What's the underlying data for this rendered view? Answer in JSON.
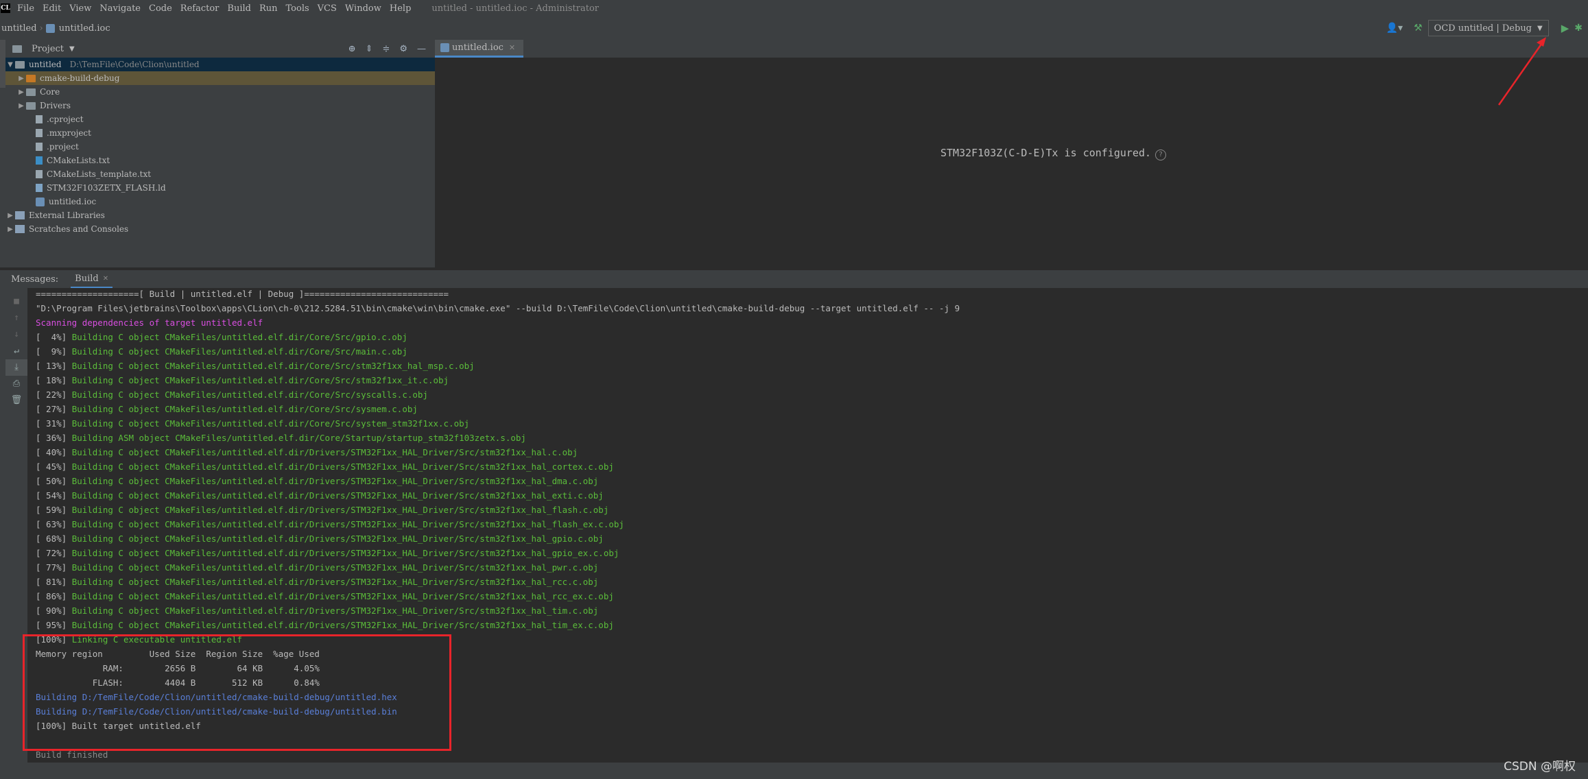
{
  "app": {
    "logo": "CL",
    "window_title": "untitled - untitled.ioc - Administrator"
  },
  "menu": [
    "File",
    "Edit",
    "View",
    "Navigate",
    "Code",
    "Refactor",
    "Build",
    "Run",
    "Tools",
    "VCS",
    "Window",
    "Help"
  ],
  "breadcrumb": {
    "project": "untitled",
    "file": "untitled.ioc"
  },
  "toolbar": {
    "run_config": "OCD untitled | Debug"
  },
  "project_panel": {
    "title": "Project"
  },
  "tree": {
    "root": {
      "label": "untitled",
      "path": "D:\\TemFile\\Code\\Clion\\untitled"
    },
    "items": [
      {
        "label": "cmake-build-debug"
      },
      {
        "label": "Core"
      },
      {
        "label": "Drivers"
      },
      {
        "label": ".cproject"
      },
      {
        "label": ".mxproject"
      },
      {
        "label": ".project"
      },
      {
        "label": "CMakeLists.txt"
      },
      {
        "label": "CMakeLists_template.txt"
      },
      {
        "label": "STM32F103ZETX_FLASH.ld"
      },
      {
        "label": "untitled.ioc"
      }
    ],
    "external": "External Libraries",
    "scratches": "Scratches and Consoles"
  },
  "editor": {
    "tab": "untitled.ioc",
    "message": "STM32F103Z(C-D-E)Tx is configured.",
    "help_glyph": "?"
  },
  "messages": {
    "label": "Messages:",
    "tab": "Build"
  },
  "console": {
    "header": "====================[ Build | untitled.elf | Debug ]============================",
    "command": "\"D:\\Program Files\\jetbrains\\Toolbox\\apps\\CLion\\ch-0\\212.5284.51\\bin\\cmake\\win\\bin\\cmake.exe\" --build D:\\TemFile\\Code\\Clion\\untitled\\cmake-build-debug --target untitled.elf -- -j 9",
    "scanning": "Scanning dependencies of target untitled.elf",
    "build_lines": [
      {
        "pct": "[  4%]",
        "text": "Building C object CMakeFiles/untitled.elf.dir/Core/Src/gpio.c.obj"
      },
      {
        "pct": "[  9%]",
        "text": "Building C object CMakeFiles/untitled.elf.dir/Core/Src/main.c.obj"
      },
      {
        "pct": "[ 13%]",
        "text": "Building C object CMakeFiles/untitled.elf.dir/Core/Src/stm32f1xx_hal_msp.c.obj"
      },
      {
        "pct": "[ 18%]",
        "text": "Building C object CMakeFiles/untitled.elf.dir/Core/Src/stm32f1xx_it.c.obj"
      },
      {
        "pct": "[ 22%]",
        "text": "Building C object CMakeFiles/untitled.elf.dir/Core/Src/syscalls.c.obj"
      },
      {
        "pct": "[ 27%]",
        "text": "Building C object CMakeFiles/untitled.elf.dir/Core/Src/sysmem.c.obj"
      },
      {
        "pct": "[ 31%]",
        "text": "Building C object CMakeFiles/untitled.elf.dir/Core/Src/system_stm32f1xx.c.obj"
      },
      {
        "pct": "[ 36%]",
        "text": "Building ASM object CMakeFiles/untitled.elf.dir/Core/Startup/startup_stm32f103zetx.s.obj"
      },
      {
        "pct": "[ 40%]",
        "text": "Building C object CMakeFiles/untitled.elf.dir/Drivers/STM32F1xx_HAL_Driver/Src/stm32f1xx_hal.c.obj"
      },
      {
        "pct": "[ 45%]",
        "text": "Building C object CMakeFiles/untitled.elf.dir/Drivers/STM32F1xx_HAL_Driver/Src/stm32f1xx_hal_cortex.c.obj"
      },
      {
        "pct": "[ 50%]",
        "text": "Building C object CMakeFiles/untitled.elf.dir/Drivers/STM32F1xx_HAL_Driver/Src/stm32f1xx_hal_dma.c.obj"
      },
      {
        "pct": "[ 54%]",
        "text": "Building C object CMakeFiles/untitled.elf.dir/Drivers/STM32F1xx_HAL_Driver/Src/stm32f1xx_hal_exti.c.obj"
      },
      {
        "pct": "[ 59%]",
        "text": "Building C object CMakeFiles/untitled.elf.dir/Drivers/STM32F1xx_HAL_Driver/Src/stm32f1xx_hal_flash.c.obj"
      },
      {
        "pct": "[ 63%]",
        "text": "Building C object CMakeFiles/untitled.elf.dir/Drivers/STM32F1xx_HAL_Driver/Src/stm32f1xx_hal_flash_ex.c.obj"
      },
      {
        "pct": "[ 68%]",
        "text": "Building C object CMakeFiles/untitled.elf.dir/Drivers/STM32F1xx_HAL_Driver/Src/stm32f1xx_hal_gpio.c.obj"
      },
      {
        "pct": "[ 72%]",
        "text": "Building C object CMakeFiles/untitled.elf.dir/Drivers/STM32F1xx_HAL_Driver/Src/stm32f1xx_hal_gpio_ex.c.obj"
      },
      {
        "pct": "[ 77%]",
        "text": "Building C object CMakeFiles/untitled.elf.dir/Drivers/STM32F1xx_HAL_Driver/Src/stm32f1xx_hal_pwr.c.obj"
      },
      {
        "pct": "[ 81%]",
        "text": "Building C object CMakeFiles/untitled.elf.dir/Drivers/STM32F1xx_HAL_Driver/Src/stm32f1xx_hal_rcc.c.obj"
      },
      {
        "pct": "[ 86%]",
        "text": "Building C object CMakeFiles/untitled.elf.dir/Drivers/STM32F1xx_HAL_Driver/Src/stm32f1xx_hal_rcc_ex.c.obj"
      },
      {
        "pct": "[ 90%]",
        "text": "Building C object CMakeFiles/untitled.elf.dir/Drivers/STM32F1xx_HAL_Driver/Src/stm32f1xx_hal_tim.c.obj"
      },
      {
        "pct": "[ 95%]",
        "text": "Building C object CMakeFiles/untitled.elf.dir/Drivers/STM32F1xx_HAL_Driver/Src/stm32f1xx_hal_tim_ex.c.obj"
      }
    ],
    "linking_pct": "[100%]",
    "linking_text": "Linking C executable untitled.elf",
    "memory_header": "Memory region         Used Size  Region Size  %age Used",
    "memory_ram": "             RAM:        2656 B        64 KB      4.05%",
    "memory_flash": "           FLASH:        4404 B       512 KB      0.84%",
    "hex_line": "Building D:/TemFile/Code/Clion/untitled/cmake-build-debug/untitled.hex",
    "bin_line": "Building D:/TemFile/Code/Clion/untitled/cmake-build-debug/untitled.bin",
    "built_target": "[100%] Built target untitled.elf",
    "finished": "Build finished"
  },
  "watermark": "CSDN @啊权",
  "colors": {
    "annotation_red": "#e8242a",
    "console_green": "#5bbd3a",
    "console_magenta": "#d84ee0",
    "console_blue": "#5a7fd8"
  }
}
